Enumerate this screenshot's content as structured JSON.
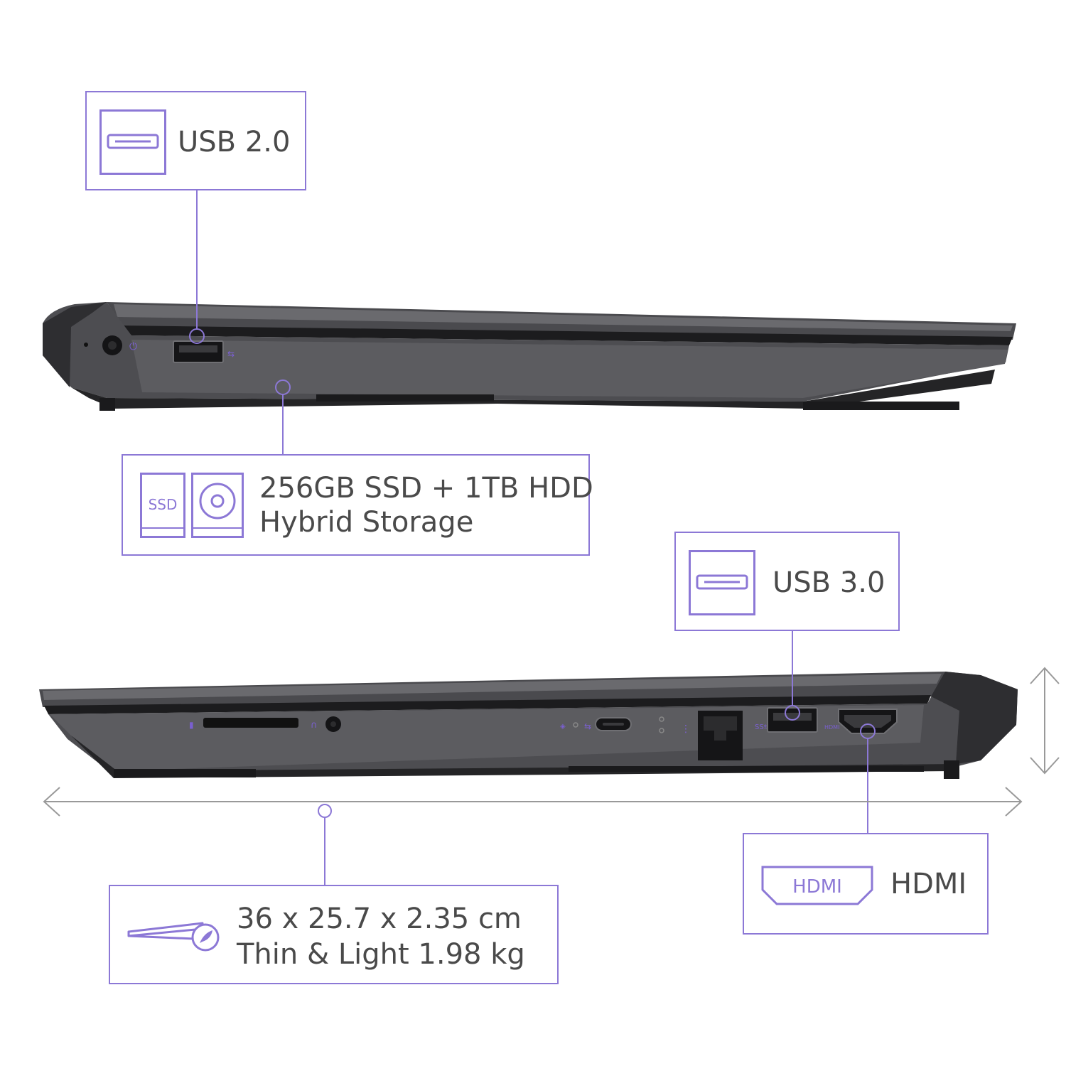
{
  "colors": {
    "accent": "#8c78d6",
    "accent_dark": "#7a5fd0",
    "label_text": "#4a4a4a",
    "laptop_body": "#3a3a3d",
    "laptop_dark": "#1f1f21",
    "laptop_highlight": "#5b5b5f"
  },
  "callouts": {
    "usb2": {
      "label": "USB 2.0",
      "icon": "usb-port-icon"
    },
    "storage": {
      "line1": "256GB SSD + 1TB HDD",
      "line2": "Hybrid Storage",
      "ssd_icon_text": "SSD",
      "icons": [
        "ssd-icon",
        "hdd-icon"
      ]
    },
    "usb3": {
      "label": "USB 3.0",
      "icon": "usb-port-icon"
    },
    "hdmi": {
      "label": "HDMI",
      "icon_text": "HDMI",
      "icon": "hdmi-port-icon"
    },
    "dimensions": {
      "line1": "36 x 25.7 x 2.35 cm",
      "line2": "Thin & Light 1.98 kg",
      "icon": "thin-laptop-feather-icon"
    }
  }
}
